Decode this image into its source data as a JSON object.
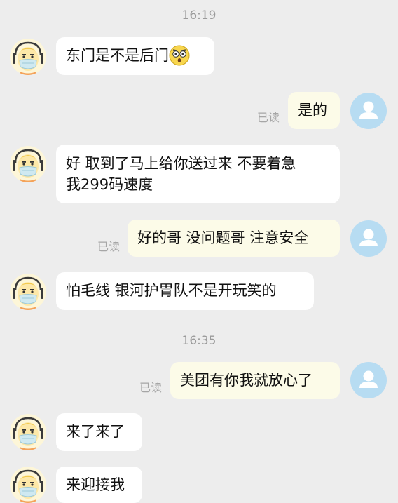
{
  "chat": {
    "read_label": "已读",
    "timestamps": [
      "16:19",
      "16:35"
    ],
    "messages": [
      {
        "from": "courier",
        "text": "东门是不是后门",
        "emoji": "astonished-face"
      },
      {
        "from": "me",
        "text": "是的"
      },
      {
        "from": "courier",
        "text": "好 取到了马上给你送过来 不要着急\n我299码速度"
      },
      {
        "from": "me",
        "text": "好的哥 没问题哥 注意安全"
      },
      {
        "from": "courier",
        "text": "怕毛线 银河护胃队不是开玩笑的"
      },
      {
        "from": "me",
        "text": "美团有你我就放心了"
      },
      {
        "from": "courier",
        "text": "来了来了"
      },
      {
        "from": "courier",
        "text": "来迎接我"
      }
    ]
  },
  "colors": {
    "background": "#ededed",
    "incoming_bubble": "#ffffff",
    "outgoing_bubble": "#fcfbe8",
    "my_avatar": "#b7dcf2",
    "courier_avatar_face": "#fde8a8",
    "courier_mask": "#cfe9f1"
  },
  "icons": {
    "courier_avatar": "cartoon-courier-with-face-mask-icon",
    "my_avatar": "default-user-silhouette-icon"
  }
}
